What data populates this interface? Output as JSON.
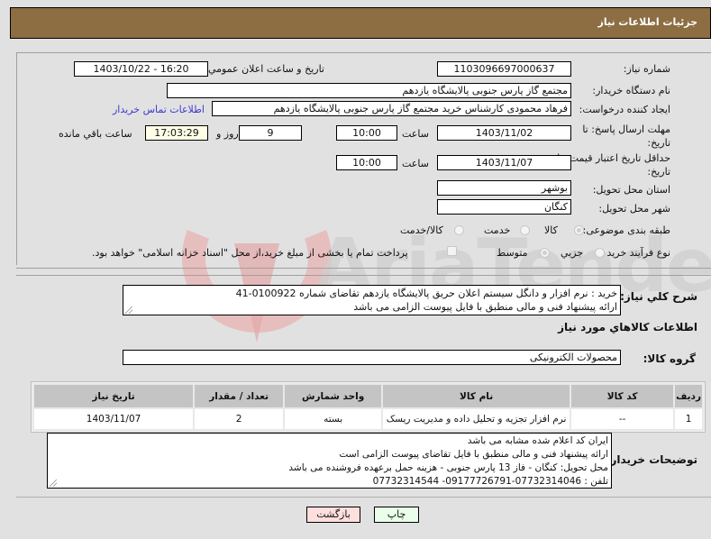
{
  "header": {
    "title": "جزئیات اطلاعات نیاز"
  },
  "form": {
    "need_number": {
      "label": "شماره نیاز:",
      "value": "1103096697000637"
    },
    "announce_datetime": {
      "label": "تاریخ و ساعت اعلان عمومي:",
      "value": "1403/10/22 - 16:20"
    },
    "buyer_org": {
      "label": "نام دستگاه خريدار:",
      "value": "مجتمع گاز پارس جنوبی  پالايشگاه يازدهم"
    },
    "requester": {
      "label": "ايجاد کننده درخواست:",
      "value": "فرهاد محمودی کارشناس خرید مجتمع گاز پارس جنوبی  پالايشگاه يازدهم",
      "contact_link": "اطلاعات تماس خریدار"
    },
    "reply_deadline": {
      "label": "مهلت ارسال پاسخ: تا تاریخ:",
      "date": "1403/11/02",
      "time_label": "ساعت",
      "time": "10:00",
      "days": "9",
      "days_label": "روز و",
      "remaining": "17:03:29",
      "remaining_label": "ساعت باقي مانده"
    },
    "price_validity": {
      "label": "حداقل تاریخ اعتبار قیمت: تا تاریخ:",
      "date": "1403/11/07",
      "time_label": "ساعت",
      "time": "10:00"
    },
    "province": {
      "label": "استان محل تحویل:",
      "value": "بوشهر"
    },
    "city": {
      "label": "شهر محل تحویل:",
      "value": "کنگان"
    },
    "category": {
      "label": "طبقه بندی موضوعی:",
      "options": [
        "کالا",
        "خدمت",
        "کالا/خدمت"
      ],
      "selected": "کالا"
    },
    "process": {
      "label": "نوع فرآیند خرید :",
      "options": [
        "جزیي",
        "متوسط"
      ],
      "selected": "متوسط",
      "payment_note": "پرداخت تمام یا بخشی از مبلغ خرید،از محل \"اسناد خزانه اسلامی\" خواهد بود."
    }
  },
  "description": {
    "label": "شرح کلي نياز:",
    "text": "خريد :  نرم افزار و دانگل سيستم اعلان حريق  پالايشگاه يازدهم تقاضای شماره 0100922-41\nارائه پیشنهاد فنی و مالی منطبق با فایل پیوست الزامی می باشد"
  },
  "goods": {
    "section_title": "اطلاعات کالاهاي مورد نياز",
    "group_label": "گروه کالا:",
    "group_value": "محصولات الکترونیکی",
    "columns": [
      "رديف",
      "کد کالا",
      "نام کالا",
      "واحد شمارش",
      "تعداد / مقدار",
      "تاريخ نياز"
    ],
    "rows": [
      {
        "row": "1",
        "code": "--",
        "name": "نرم افزار تجزیه و تحلیل داده و مدیریت ریسک",
        "unit": "بسته",
        "qty": "2",
        "date": "1403/11/07"
      }
    ]
  },
  "buyer_notes": {
    "label": "توضيحات خريدار:",
    "text": "ایران کد اعلام شده مشابه می باشد\n ارائه پیشنهاد فنی و مالی منطبق با فایل تقاضای پیوست الزامی است\nمحل تحویل: کنگان - فاز 13 پارس جنوبی - هزینه حمل برعهده فروشنده می باشد\nتلفن : 07732314046-09177726791- 07732314544"
  },
  "buttons": {
    "print": "چاپ",
    "back": "بازگشت"
  },
  "colors": {
    "header_bg": "#8d6d42",
    "print_bg": "#eaffea",
    "back_bg": "#ffdede",
    "link": "#3a3ad0",
    "remaining_bg": "#ffffe8"
  },
  "watermark": {
    "text": "AriaTender.neT"
  }
}
